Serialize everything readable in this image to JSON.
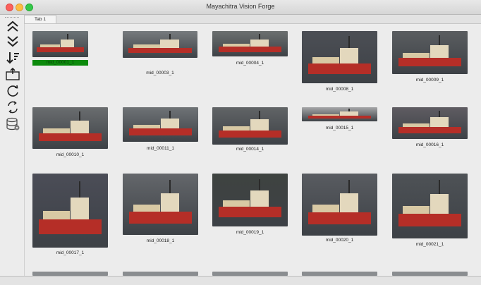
{
  "window": {
    "title": "Mayachitra Vision Forge"
  },
  "tabs": [
    {
      "label": "Tab 1"
    }
  ],
  "toolbar": {
    "tools": [
      {
        "icon": "double-chevron-up-icon"
      },
      {
        "icon": "double-chevron-down-icon"
      },
      {
        "icon": "sort-descending-icon"
      },
      {
        "icon": "export-folder-icon"
      },
      {
        "icon": "refresh-icon"
      },
      {
        "icon": "sync-icon"
      },
      {
        "icon": "database-settings-icon"
      }
    ]
  },
  "gallery": {
    "items": [
      {
        "label": "mid_00001_1",
        "selected": true
      },
      {
        "label": "mid_00003_1",
        "selected": false
      },
      {
        "label": "mid_00004_1",
        "selected": false
      },
      {
        "label": "mid_00008_1",
        "selected": false
      },
      {
        "label": "mid_00009_1",
        "selected": false
      },
      {
        "label": "mid_00010_1",
        "selected": false
      },
      {
        "label": "mid_00011_1",
        "selected": false
      },
      {
        "label": "mid_00014_1",
        "selected": false
      },
      {
        "label": "mid_00015_1",
        "selected": false
      },
      {
        "label": "mid_00016_1",
        "selected": false
      },
      {
        "label": "mid_00017_1",
        "selected": false
      },
      {
        "label": "mid_00018_1",
        "selected": false
      },
      {
        "label": "mid_00019_1",
        "selected": false
      },
      {
        "label": "mid_00020_1",
        "selected": false
      },
      {
        "label": "mid_00021_1",
        "selected": false
      }
    ]
  },
  "colors": {
    "selection": "#0b8a0b",
    "hull": "#b52e27",
    "sea": "#5b6066"
  }
}
